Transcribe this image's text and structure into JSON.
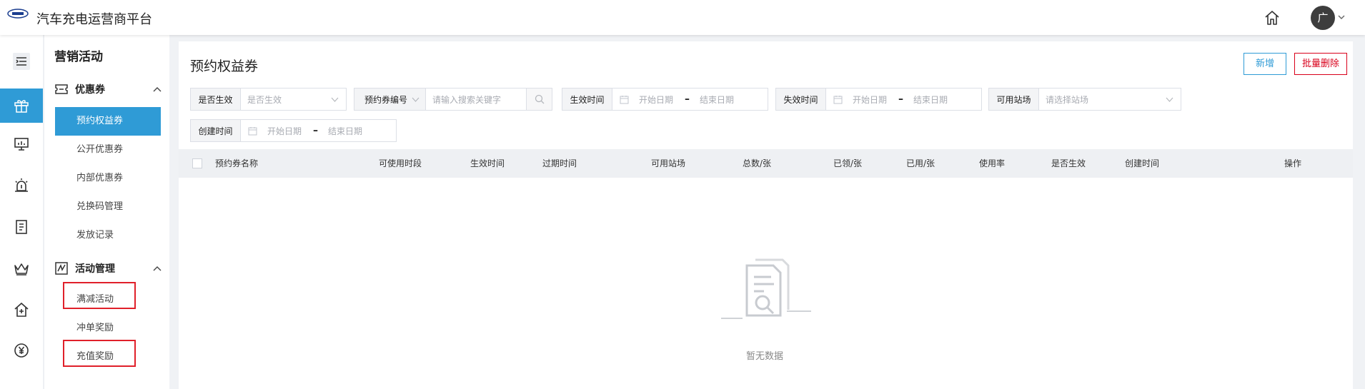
{
  "app": {
    "title": "汽车充电运营商平台",
    "avatar_initial": "广",
    "colors": {
      "accent": "#2f9bd6",
      "danger": "#d9001b",
      "highlight_box": "#e0202a"
    }
  },
  "rail": {
    "items": [
      {
        "icon": "menu-toggle-icon",
        "active": false
      },
      {
        "icon": "gift-icon",
        "active": true
      },
      {
        "icon": "monitor-icon",
        "active": false
      },
      {
        "icon": "alarm-icon",
        "active": false
      },
      {
        "icon": "document-icon",
        "active": false
      },
      {
        "icon": "crown-icon",
        "active": false
      },
      {
        "icon": "house-plus-icon",
        "active": false
      },
      {
        "icon": "yen-icon",
        "active": false
      }
    ]
  },
  "subnav": {
    "title": "营销活动",
    "groups": [
      {
        "label": "优惠券",
        "icon": "coupon-icon",
        "expanded": true,
        "items": [
          {
            "label": "预约权益券",
            "active": true
          },
          {
            "label": "公开优惠券",
            "active": false
          },
          {
            "label": "内部优惠券",
            "active": false
          },
          {
            "label": "兑换码管理",
            "active": false
          },
          {
            "label": "发放记录",
            "active": false
          }
        ]
      },
      {
        "label": "活动管理",
        "icon": "activity-icon",
        "expanded": true,
        "items": [
          {
            "label": "满减活动",
            "active": false,
            "highlighted": true
          },
          {
            "label": "冲单奖励",
            "active": false,
            "highlighted": false
          },
          {
            "label": "充值奖励",
            "active": false,
            "highlighted": true
          }
        ]
      }
    ]
  },
  "main": {
    "page_title": "预约权益券",
    "buttons": {
      "new": "新增",
      "batch_delete": "批量删除"
    },
    "filters": {
      "effective": {
        "label": "是否生效",
        "placeholder": "是否生效"
      },
      "code": {
        "label": "预约券编号",
        "placeholder": "请输入搜索关键字"
      },
      "effective_time": {
        "label": "生效时间",
        "start": "开始日期",
        "end": "结束日期"
      },
      "expire_time": {
        "label": "失效时间",
        "start": "开始日期",
        "end": "结束日期"
      },
      "station": {
        "label": "可用站场",
        "placeholder": "请选择站场"
      },
      "created_time": {
        "label": "创建时间",
        "start": "开始日期",
        "end": "结束日期"
      }
    },
    "table": {
      "columns": [
        "预约券名称",
        "可使用时段",
        "生效时间",
        "过期时间",
        "可用站场",
        "总数/张",
        "已领/张",
        "已用/张",
        "使用率",
        "是否生效",
        "创建时间",
        "操作"
      ],
      "rows": []
    },
    "empty_text": "暂无数据"
  }
}
